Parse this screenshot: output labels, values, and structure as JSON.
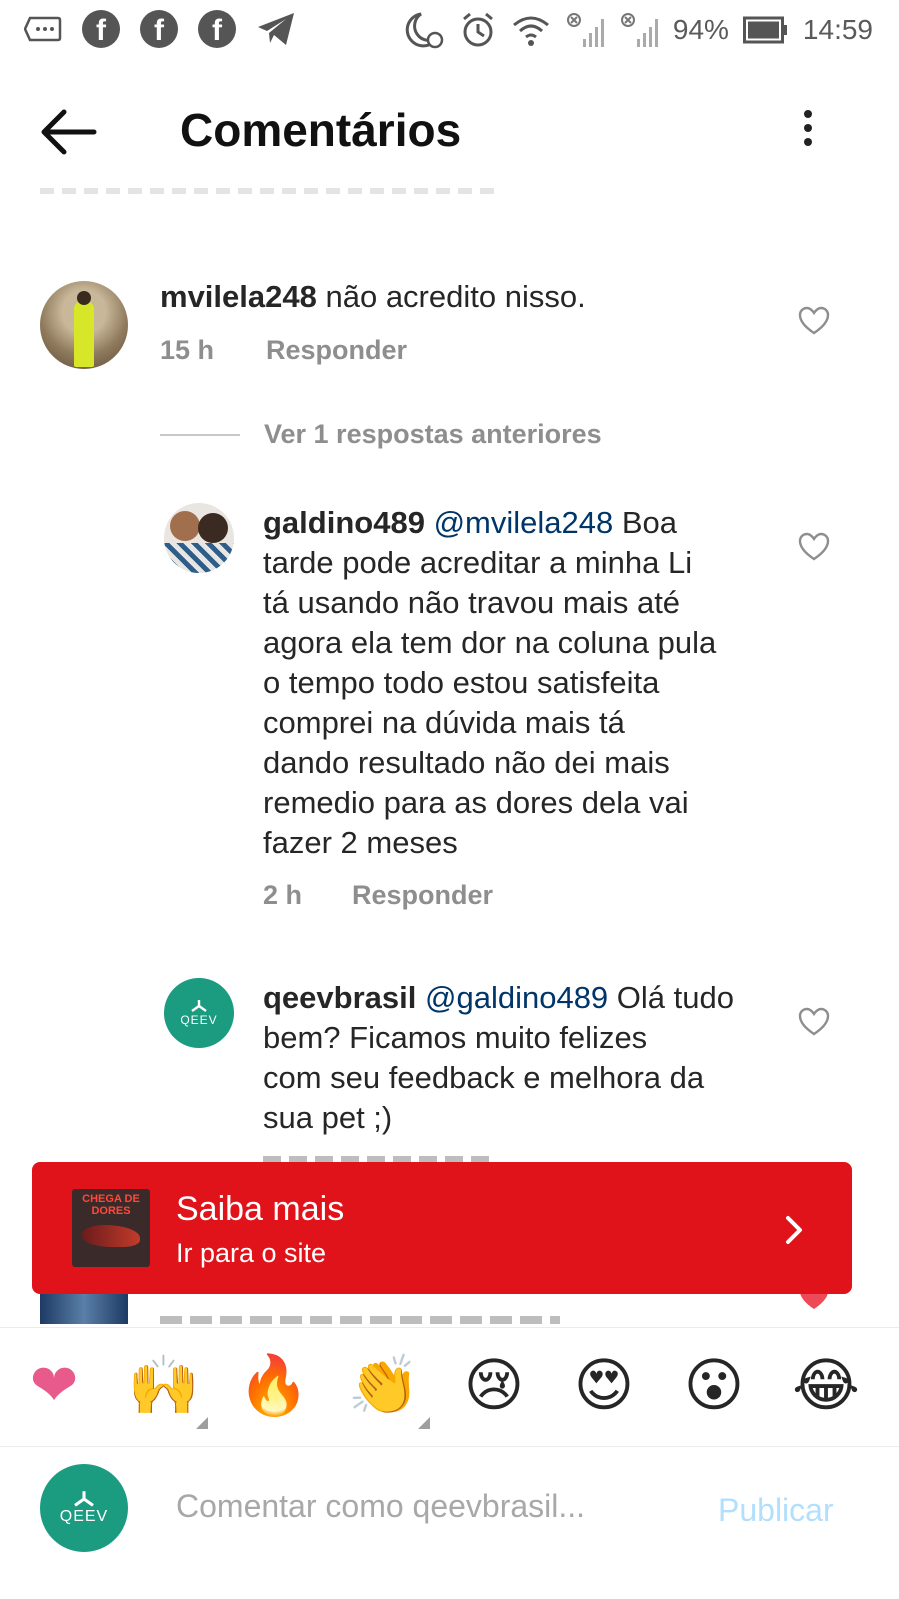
{
  "status_bar": {
    "battery": "94%",
    "time": "14:59"
  },
  "header": {
    "title": "Comentários"
  },
  "comments": [
    {
      "username": "mvilela248",
      "text": "não acredito nisso.",
      "time": "15 h",
      "reply_label": "Responder"
    }
  ],
  "replies_toggle": "Ver 1 respostas anteriores",
  "replies": [
    {
      "username": "galdino489",
      "mention": "@mvilela248",
      "lines": [
        "Boa",
        "tarde pode acreditar a minha Li",
        "tá usando não travou mais até",
        "agora ela tem dor na coluna pula",
        "o tempo todo estou satisfeita",
        "comprei na dúvida mais tá",
        "dando resultado não dei mais",
        "remedio para as dores dela vai",
        "fazer 2 meses"
      ],
      "time": "2 h",
      "reply_label": "Responder"
    },
    {
      "username": "qeevbrasil",
      "mention": "@galdino489",
      "lines": [
        "Olá tudo",
        "bem? Ficamos muito felizes",
        "com seu feedback e melhora da",
        "sua pet ;)"
      ]
    }
  ],
  "banner": {
    "title": "Saiba mais",
    "subtitle": "Ir para o site",
    "thumb_text": "CHEGA DE DORES",
    "color": "#e1131a"
  },
  "emojis": [
    "❤",
    "🙌",
    "🔥",
    "👏",
    "😢",
    "😍",
    "😮",
    "😂"
  ],
  "composer": {
    "placeholder": "Comentar como qeevbrasil...",
    "publish_label": "Publicar",
    "logo_text": "QEEV"
  }
}
